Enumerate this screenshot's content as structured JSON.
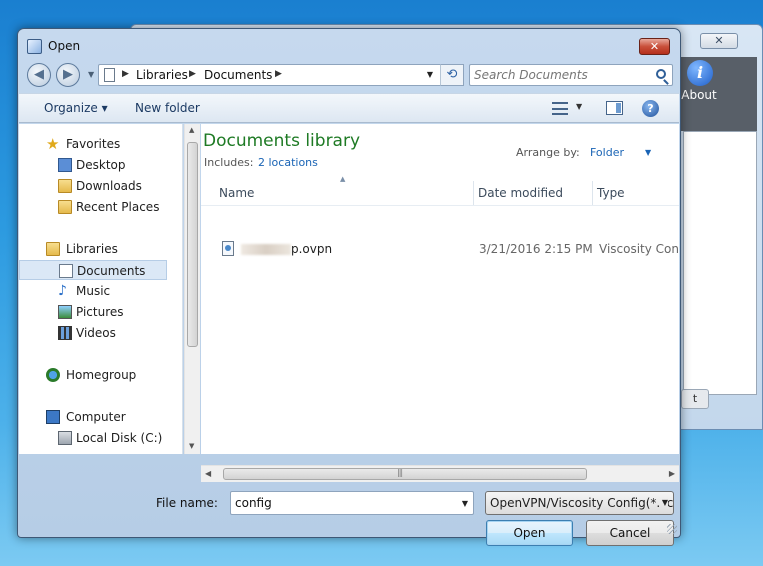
{
  "background_window": {
    "close_glyph": "✕",
    "about_icon_glyph": "i",
    "about_label": "About",
    "button_label": "t"
  },
  "dialog": {
    "title": "Open",
    "close_glyph": "✕"
  },
  "address_bar": {
    "back_glyph": "◀",
    "forward_glyph": "▶",
    "breadcrumb": [
      "Libraries",
      "Documents"
    ],
    "refresh_glyph": "⟲"
  },
  "search": {
    "placeholder": "Search Documents"
  },
  "toolbar": {
    "organize_label": "Organize ▾",
    "new_folder_label": "New folder",
    "help_glyph": "?"
  },
  "nav_pane": {
    "favorites_label": "Favorites",
    "desktop_label": "Desktop",
    "downloads_label": "Downloads",
    "recent_label": "Recent Places",
    "libraries_label": "Libraries",
    "documents_label": "Documents",
    "music_label": "Music",
    "pictures_label": "Pictures",
    "videos_label": "Videos",
    "homegroup_label": "Homegroup",
    "computer_label": "Computer",
    "localdisk_label": "Local Disk (C:)"
  },
  "library_header": {
    "title": "Documents library",
    "includes_label": "Includes:",
    "locations_link": "2 locations",
    "arrange_label": "Arrange by:",
    "arrange_value": "Folder"
  },
  "columns": {
    "name": "Name",
    "date_modified": "Date modified",
    "type": "Type"
  },
  "files": [
    {
      "name": "p.ovpn",
      "date_modified": "3/21/2016 2:15 PM",
      "type": "Viscosity Connec"
    }
  ],
  "bottom": {
    "file_name_label": "File name:",
    "file_name_value": "config",
    "filter_value": "OpenVPN/Viscosity Config(*.cc",
    "open_label": "Open",
    "cancel_label": "Cancel"
  },
  "colors": {
    "library_title": "#1e7a24",
    "link": "#1a64b5",
    "close_button": "#c9503b",
    "selection": "#dbe8f6"
  }
}
